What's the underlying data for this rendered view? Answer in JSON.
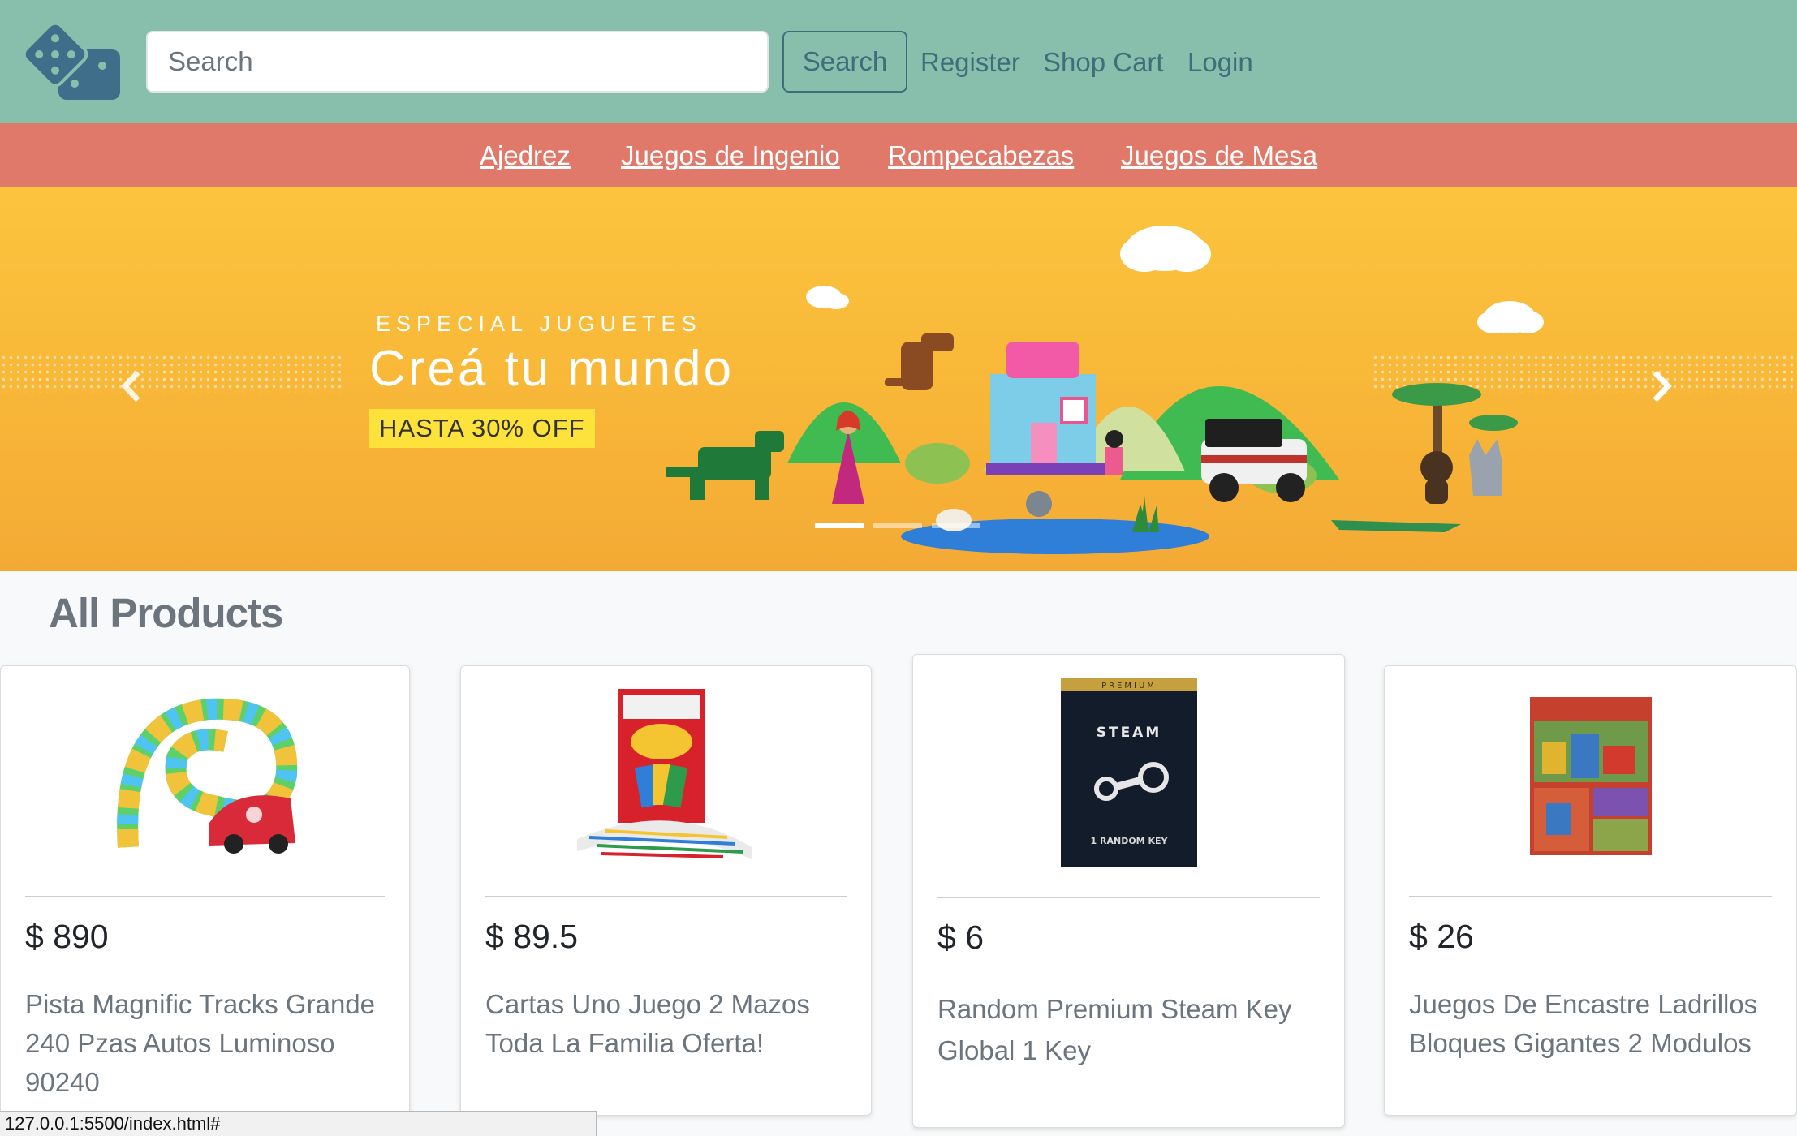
{
  "header": {
    "logo_icon": "dice-icon",
    "search": {
      "placeholder": "Search",
      "value": ""
    },
    "search_button": "Search",
    "links": [
      "Register",
      "Shop Cart",
      "Login"
    ]
  },
  "categories": [
    "Ajedrez",
    "Juegos de Ingenio",
    "Rompecabezas",
    "Juegos de Mesa"
  ],
  "carousel": {
    "kicker": "ESPECIAL JUGUETES",
    "headline": "Creá tu mundo",
    "offer": "HASTA 30% OFF",
    "prev_icon": "chevron-left-icon",
    "next_icon": "chevron-right-icon",
    "slide_count": 3,
    "active_slide": 1
  },
  "products_section": {
    "title": "All Products",
    "products": [
      {
        "price": "$ 890",
        "name": "Pista Magnific Tracks Grande 240 Pzas Autos Luminoso 90240",
        "image": "glow-track-toy"
      },
      {
        "price": "$ 89.5",
        "name": "Cartas Uno Juego 2 Mazos Toda La Familia Oferta!",
        "image": "uno-cards"
      },
      {
        "price": "$ 6",
        "name": "Random Premium Steam Key Global 1 Key",
        "image": "steam-key-card",
        "image_text": {
          "top": "PREMIUM",
          "brand": "STEAM",
          "bottom": "1 RANDOM KEY"
        }
      },
      {
        "price": "$ 26",
        "name": "Juegos De Encastre Ladrillos Bloques Gigantes 2 Modulos",
        "image": "giant-blocks-box"
      }
    ]
  },
  "status_bar": {
    "url": "127.0.0.1:5500/index.html#"
  },
  "colors": {
    "topbar": "#88bfac",
    "catbar": "#e0796a",
    "banner": "#fbc43e",
    "link": "#3f6e7b"
  }
}
